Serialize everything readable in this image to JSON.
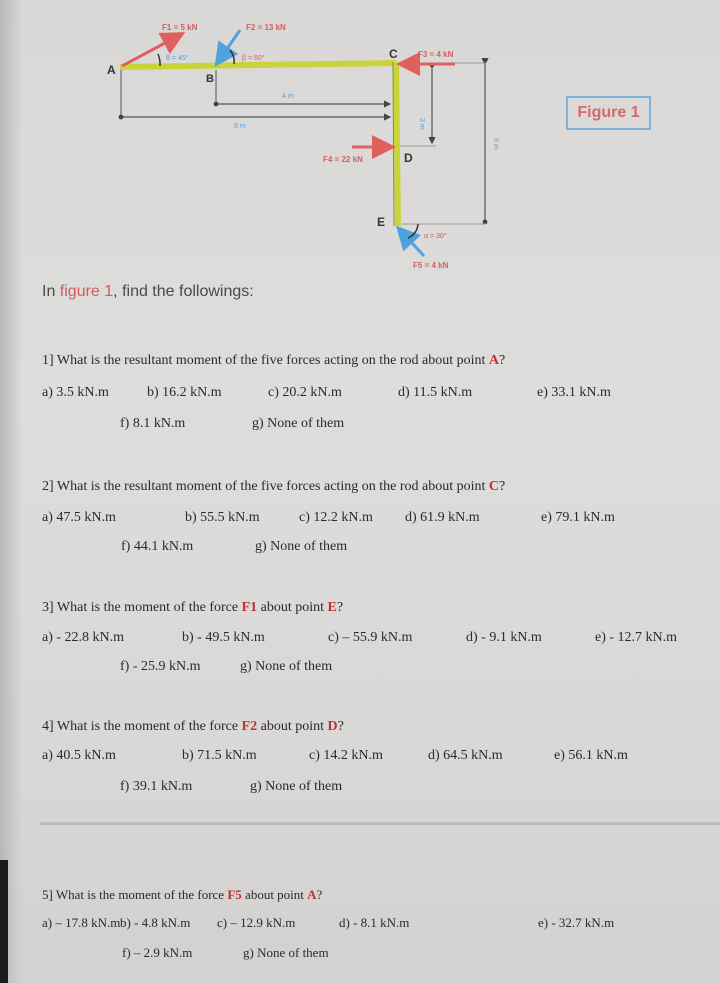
{
  "figure": {
    "label": "Figure 1",
    "points": {
      "A": "A",
      "B": "B",
      "C": "C",
      "D": "D",
      "E": "E"
    },
    "forces": {
      "F1": "F1 = 5 kN",
      "F2": "F2 = 13 kN",
      "F3": "F3 = 4 kN",
      "F4": "F4 = 22 kN",
      "F5": "F5 = 4 kN"
    },
    "angles": {
      "theta": "θ = 45°",
      "beta": "β = 60°",
      "alpha": "α = 30°"
    },
    "dimensions": {
      "BC": "4 m",
      "AC": "8 m",
      "CD": "3 m",
      "CE": "6 m"
    },
    "colors": {
      "rod": "#c9d43a",
      "force_red": "#e06060",
      "force_blue": "#4fa3dc",
      "dim_text": "#5a9fd8"
    }
  },
  "intro": {
    "prefix": "In ",
    "highlight": "figure 1",
    "suffix": ", find the followings:"
  },
  "questions": [
    {
      "number": "1]",
      "text_before": "What is the resultant moment of the five forces acting on the rod about point ",
      "highlight": "A",
      "text_after": "?",
      "options": [
        "a) 3.5 kN.m",
        "b) 16.2 kN.m",
        "c) 20.2 kN.m",
        "d) 11.5 kN.m",
        "e) 33.1 kN.m",
        "f) 8.1 kN.m",
        "g) None of them"
      ]
    },
    {
      "number": "2]",
      "text_before": "What is the resultant moment of the five forces acting on the rod about point ",
      "highlight": "C",
      "text_after": "?",
      "options": [
        "a) 47.5 kN.m",
        "b) 55.5 kN.m",
        "c) 12.2 kN.m",
        "d) 61.9 kN.m",
        "e) 79.1 kN.m",
        "f) 44.1 kN.m",
        "g) None of them"
      ]
    },
    {
      "number": "3]",
      "text_before": "What is the moment of the force ",
      "highlight": "F1",
      "text_middle": " about point ",
      "highlight2": "E",
      "text_after": "?",
      "options": [
        "a) - 22.8 kN.m",
        "b) - 49.5 kN.m",
        "c) – 55.9 kN.m",
        "d) - 9.1 kN.m",
        "e) - 12.7 kN.m",
        "f) - 25.9 kN.m",
        "g) None of them"
      ]
    },
    {
      "number": "4]",
      "text_before": "What is the moment of the force ",
      "highlight": "F2",
      "text_middle": " about point ",
      "highlight2": "D",
      "text_after": "?",
      "options": [
        "a) 40.5 kN.m",
        "b) 71.5 kN.m",
        "c) 14.2 kN.m",
        "d) 64.5 kN.m",
        "e) 56.1 kN.m",
        "f) 39.1 kN.m",
        "g) None of them"
      ]
    },
    {
      "number": "5]",
      "text_before": "What is the moment of the force ",
      "highlight": "F5",
      "text_middle": " about point ",
      "highlight2": "A",
      "text_after": "?",
      "options": [
        "a) – 17.8 kN.m",
        "b) - 4.8 kN.m",
        "c) – 12.9 kN.m",
        "d) - 8.1 kN.m",
        "e) - 32.7 kN.m",
        "f) – 2.9 kN.m",
        "g) None of them"
      ]
    }
  ]
}
